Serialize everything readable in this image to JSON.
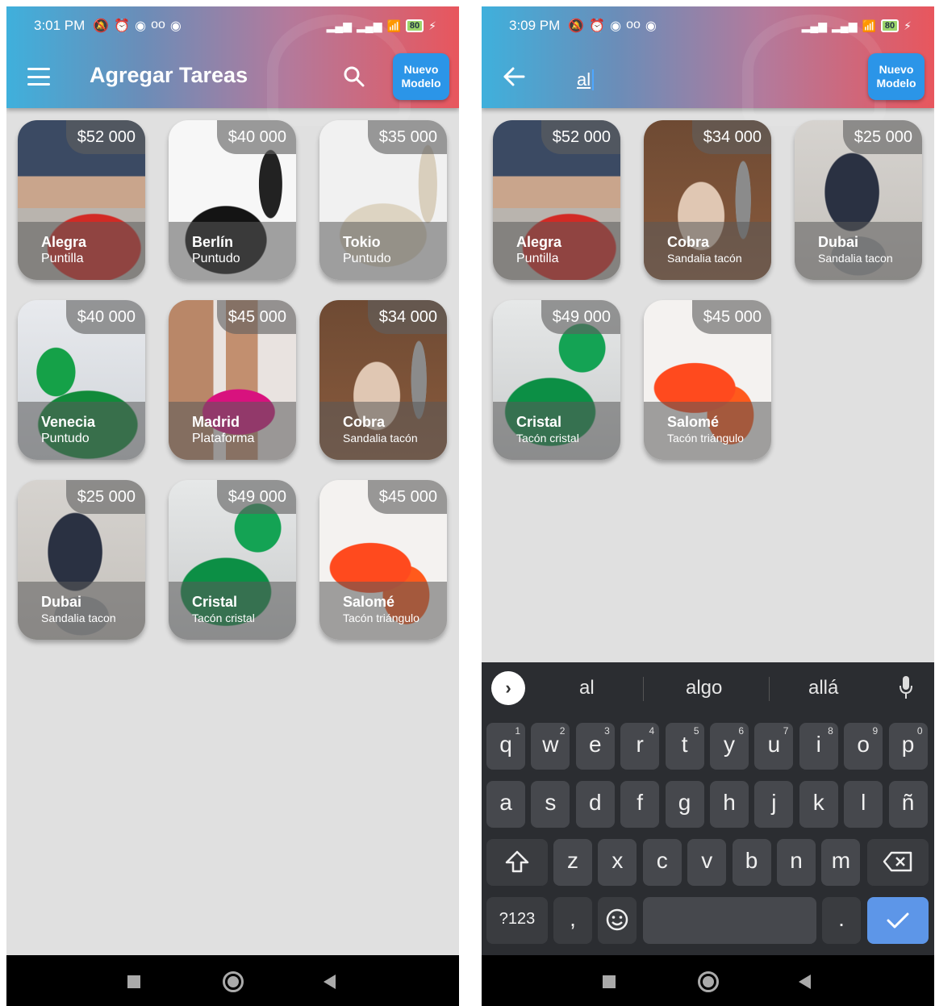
{
  "left": {
    "status": {
      "time": "3:01 PM",
      "battery": "80"
    },
    "appbar": {
      "title": "Agregar Tareas",
      "new_button": [
        "Nuevo",
        "Modelo"
      ]
    },
    "cards": [
      {
        "price": "$52 000",
        "name": "Alegra",
        "desc": "Puntilla",
        "image": "red-heel-photo"
      },
      {
        "price": "$40 000",
        "name": "Berlín",
        "desc": "Puntudo",
        "image": "black-slingback-photo"
      },
      {
        "price": "$35 000",
        "name": "Tokio",
        "desc": "Puntudo",
        "image": "cream-slingback-photo"
      },
      {
        "price": "$40 000",
        "name": "Venecia",
        "desc": "Puntudo",
        "image": "green-slingback-photo"
      },
      {
        "price": "$45 000",
        "name": "Madrid",
        "desc": "Plataforma",
        "image": "pink-platform-photo"
      },
      {
        "price": "$34 000",
        "name": "Cobra",
        "desc": "Sandalia tacón",
        "image": "snake-sandal-photo"
      },
      {
        "price": "$25 000",
        "name": "Dubai",
        "desc": "Sandalia tacon",
        "image": "clear-heel-sandal-photo"
      },
      {
        "price": "$49 000",
        "name": "Cristal",
        "desc": "Tacón cristal",
        "image": "green-mule-photo"
      },
      {
        "price": "$45 000",
        "name": "Salomé",
        "desc": "Tacón triángulo",
        "image": "orange-mule-photo"
      }
    ]
  },
  "right": {
    "status": {
      "time": "3:09 PM",
      "battery": "80"
    },
    "appbar": {
      "search_value": "al",
      "new_button": [
        "Nuevo",
        "Modelo"
      ]
    },
    "cards": [
      {
        "price": "$52 000",
        "name": "Alegra",
        "desc": "Puntilla",
        "image": "red-heel-photo"
      },
      {
        "price": "$34 000",
        "name": "Cobra",
        "desc": "Sandalia tacón",
        "image": "snake-sandal-photo"
      },
      {
        "price": "$25 000",
        "name": "Dubai",
        "desc": "Sandalia tacon",
        "image": "clear-heel-sandal-photo"
      },
      {
        "price": "$49 000",
        "name": "Cristal",
        "desc": "Tacón cristal",
        "image": "green-mule-photo"
      },
      {
        "price": "$45 000",
        "name": "Salomé",
        "desc": "Tacón triángulo",
        "image": "orange-mule-photo"
      }
    ],
    "keyboard": {
      "suggestions": [
        "al",
        "algo",
        "allá"
      ],
      "row1": [
        "q",
        "w",
        "e",
        "r",
        "t",
        "y",
        "u",
        "i",
        "o",
        "p"
      ],
      "row1_hints": [
        "1",
        "2",
        "3",
        "4",
        "5",
        "6",
        "7",
        "8",
        "9",
        "0"
      ],
      "row2": [
        "a",
        "s",
        "d",
        "f",
        "g",
        "h",
        "j",
        "k",
        "l",
        "ñ"
      ],
      "row3": [
        "z",
        "x",
        "c",
        "v",
        "b",
        "n",
        "m"
      ],
      "symbols_key": "?123",
      "comma_key": ",",
      "period_key": "."
    }
  },
  "colors": {
    "appbar_start": "#3fb0dc",
    "appbar_end": "#e8565d",
    "new_button": "#2b95e8",
    "keyboard_bg": "#2b2d31",
    "enter_key": "#5d96e8"
  }
}
